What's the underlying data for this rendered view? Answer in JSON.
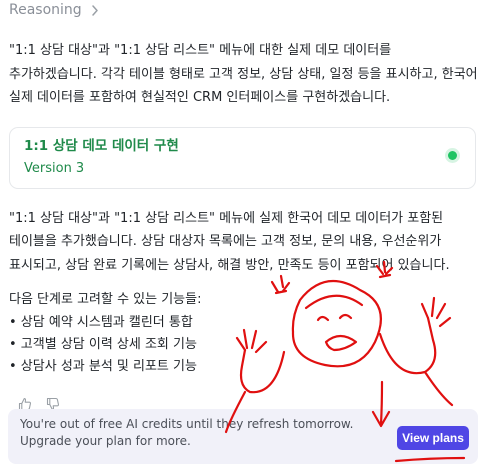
{
  "reasoning": {
    "label": "Reasoning"
  },
  "message": {
    "intro": "\"1:1 상담 대상\"과 \"1:1 상담 리스트\" 메뉴에 대한 실제 데모 데이터를 추가하겠습니다. 각각 테이블 형태로 고객 정보, 상담 상태, 일정 등을 표시하고, 한국어 실제 데이터를 포함하여 현실적인 CRM 인터페이스를 구현하겠습니다.",
    "artifact": {
      "title": "1:1 상담 데모 데이터 구현",
      "version": "Version 3",
      "status_color": "#1fc463"
    },
    "summary": "\"1:1 상담 대상\"과 \"1:1 상담 리스트\" 메뉴에 실제 한국어 데모 데이터가 포함된 테이블을 추가했습니다. 상담 대상자 목록에는 고객 정보, 문의 내용, 우선순위가 표시되고, 상담 완료 기록에는 상담사, 해결 방안, 만족도 등이 포함되어 있습니다.",
    "next_intro": "다음 단계로 고려할 수 있는 기능들:",
    "next_items": [
      "• 상담 예약 시스템과 캘린더 통합",
      "• 고객별 상담 이력 상세 조회 기능",
      "• 상담사 성과 분석 및 리포트 기능"
    ]
  },
  "feedback": {
    "like_icon": "thumbs-up-icon",
    "dislike_icon": "thumbs-down-icon"
  },
  "banner": {
    "text": "You're out of free AI credits until they refresh tomorrow. Upgrade your plan for more.",
    "button_label": "View plans",
    "button_color": "#4f46e5"
  },
  "annotation": {
    "color": "#e01010"
  }
}
